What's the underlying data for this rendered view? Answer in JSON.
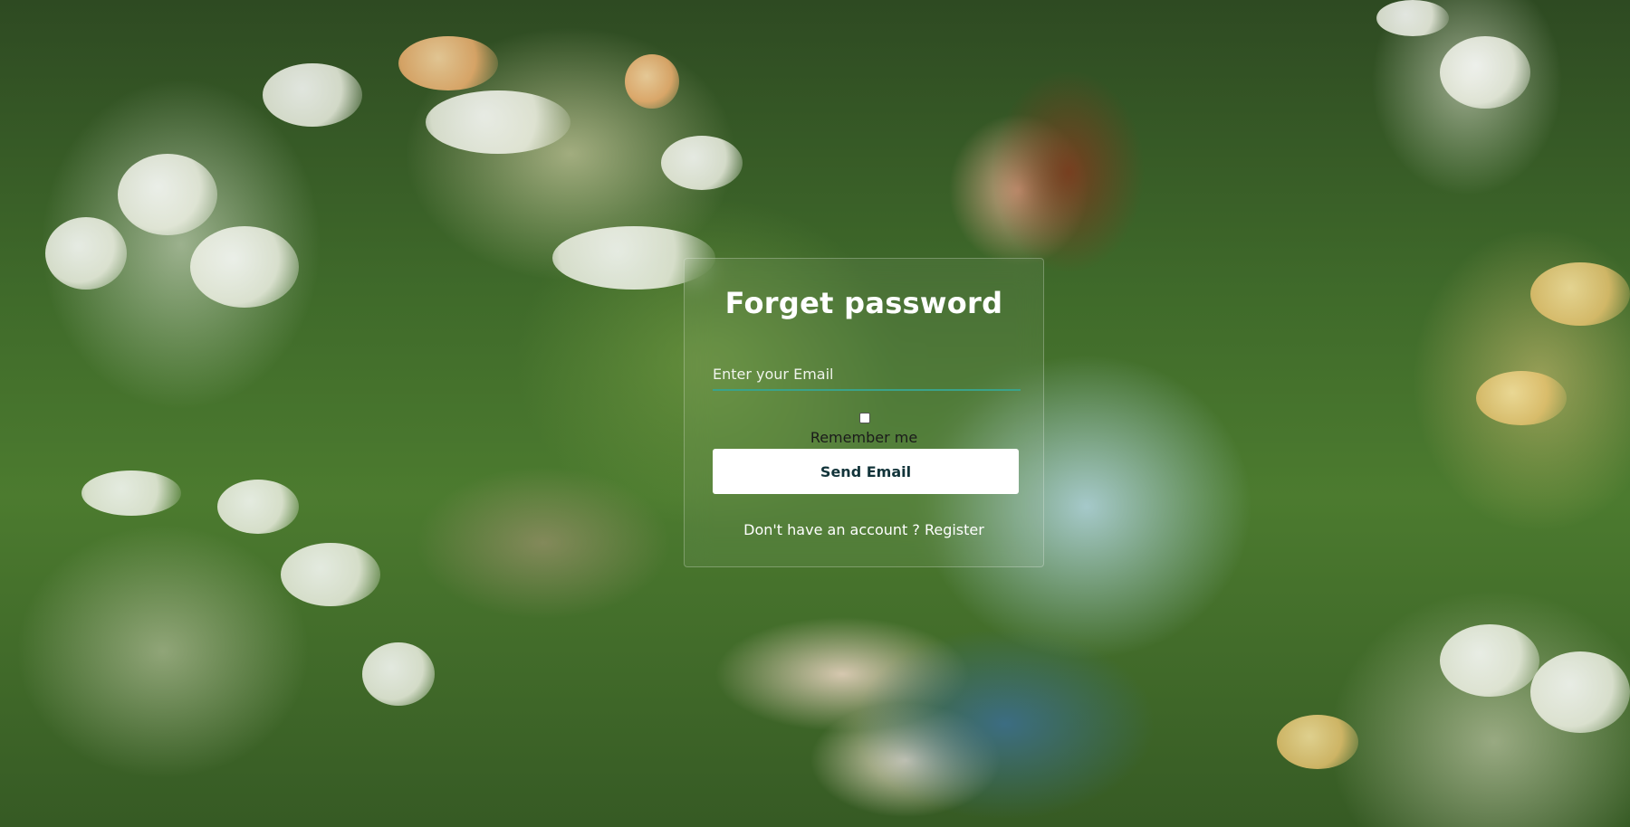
{
  "form": {
    "title": "Forget password",
    "email_placeholder": "Enter your Email",
    "email_value": "",
    "remember_checked": false,
    "remember_label": "Remember me",
    "submit_label": "Send Email",
    "register_prompt": "Don't have an account ?",
    "register_link": "Register"
  },
  "colors": {
    "input_underline": "#3aa38a",
    "button_bg": "#ffffff",
    "button_text": "#12343a",
    "title_text": "#ffffff"
  }
}
